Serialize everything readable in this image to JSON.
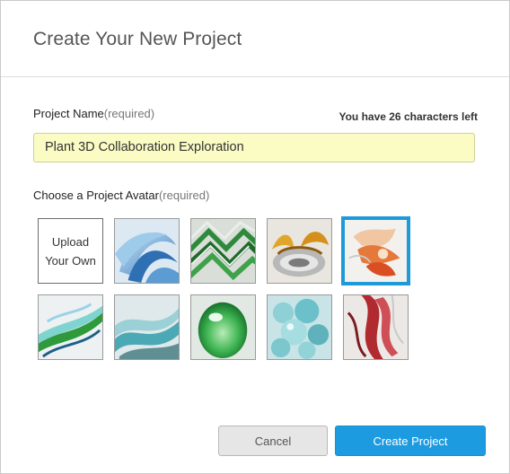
{
  "dialog": {
    "title": "Create Your New Project"
  },
  "project_name": {
    "label": "Project Name",
    "required": "(required)",
    "counter": "You have 26 characters left",
    "value": "Plant 3D Collaboration Exploration"
  },
  "avatar": {
    "label": "Choose a Project Avatar",
    "required": "(required)",
    "upload_line1": "Upload",
    "upload_line2": "Your Own",
    "selected_index": 4,
    "accent_color": "#1e9ad9",
    "tiles": [
      {
        "name": "blue-ribbon-swirl"
      },
      {
        "name": "green-chevron-pattern"
      },
      {
        "name": "gold-chrome-petals"
      },
      {
        "name": "orange-glass-sculpture"
      },
      {
        "name": "green-glass-twist"
      },
      {
        "name": "teal-glass-waves"
      },
      {
        "name": "green-droplet-orb"
      },
      {
        "name": "aqua-bubbles"
      },
      {
        "name": "red-ribbon-twist"
      }
    ]
  },
  "buttons": {
    "cancel": "Cancel",
    "create": "Create Project",
    "primary_color": "#1d9be0"
  }
}
